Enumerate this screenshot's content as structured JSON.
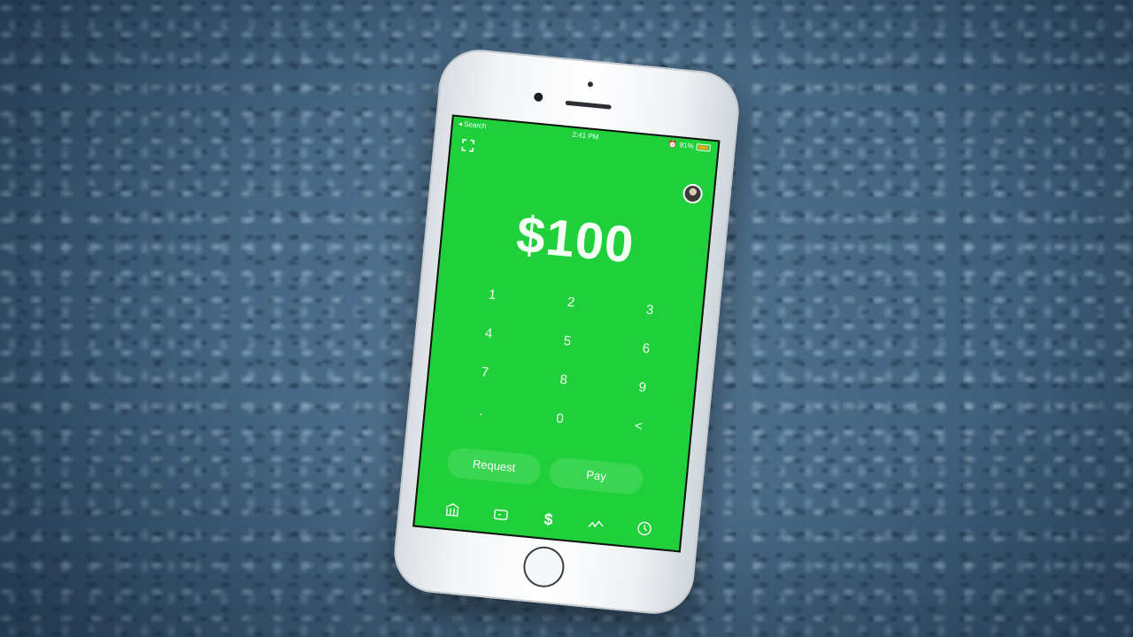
{
  "status_bar": {
    "back_label": "◂ Search",
    "time": "2:41 PM",
    "battery_percent": "81%",
    "battery_level": 0.81,
    "icons": [
      "airplane-icon",
      "alarm-icon",
      "battery-icon"
    ]
  },
  "header": {
    "scan_icon": "qr-scan-icon",
    "avatar": "profile-avatar"
  },
  "amount": {
    "display": "$100"
  },
  "keypad": {
    "keys": [
      "1",
      "2",
      "3",
      "4",
      "5",
      "6",
      "7",
      "8",
      "9",
      ".",
      "0",
      "<"
    ]
  },
  "actions": {
    "request_label": "Request",
    "pay_label": "Pay"
  },
  "tabbar": {
    "items": [
      "bank-icon",
      "card-icon",
      "dollar-icon",
      "activity-icon",
      "clock-icon"
    ],
    "dollar_symbol": "$"
  },
  "colors": {
    "screen_green": "#1fd03a",
    "background": "#4b6a85"
  }
}
